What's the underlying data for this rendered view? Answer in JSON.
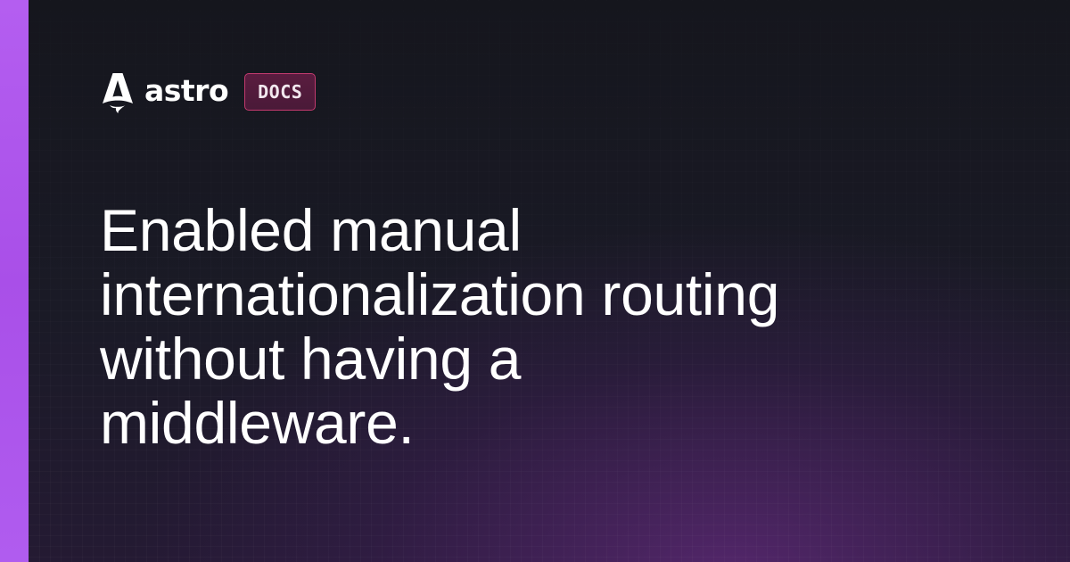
{
  "brand": {
    "icon": "astro-rocket-icon",
    "wordmark": "astro",
    "badge": "DOCS"
  },
  "headline": {
    "lines": [
      "Enabled manual",
      "internationalization routing",
      "without having a",
      "middleware."
    ]
  },
  "colors": {
    "accent_bar": "#b45ef0",
    "badge_border": "#c23a6e",
    "badge_fill": "#4a1a38",
    "background": "#17181f",
    "glow": "#783096",
    "text": "#ffffff"
  }
}
